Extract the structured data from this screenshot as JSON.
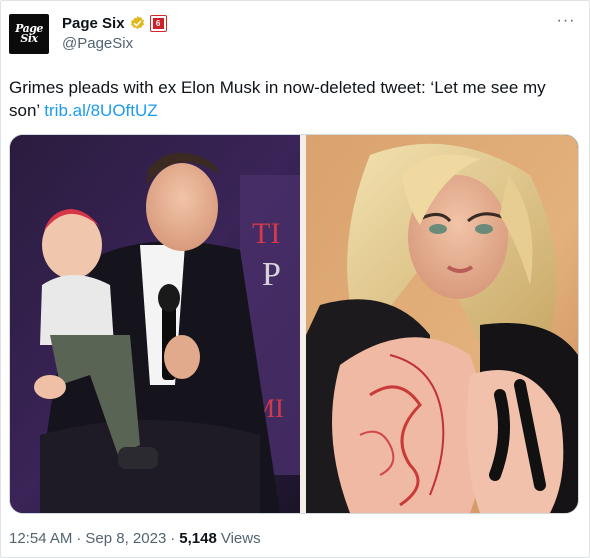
{
  "author": {
    "avatar_line1": "Page",
    "avatar_line2": "Six",
    "display_name": "Page Six",
    "handle": "@PageSix",
    "verified_icon": "gold-verified-badge",
    "affiliate_icon": "page-six-affiliate-badge"
  },
  "tweet": {
    "text": "Grimes pleads with ex Elon Musk in now-deleted tweet: ‘Let me see my son’",
    "link": "trib.al/8UOftUZ"
  },
  "media": {
    "left_sign_text_1": "TI",
    "left_sign_text_2": "P",
    "left_sign_text_3": "MI"
  },
  "meta": {
    "time": "12:54 AM",
    "date": "Sep 8, 2023",
    "views_count": "5,148",
    "views_label": "Views"
  },
  "icons": {
    "more": "more-dots-icon"
  }
}
